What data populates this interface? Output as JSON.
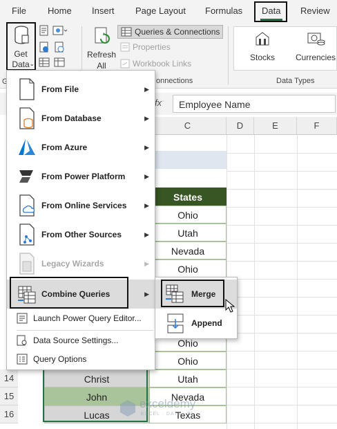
{
  "tabs": [
    "File",
    "Home",
    "Insert",
    "Page Layout",
    "Formulas",
    "Data",
    "Review"
  ],
  "active_tab": "Data",
  "ribbon": {
    "get_data": {
      "line1": "Get",
      "line2": "Data"
    },
    "refresh_all": {
      "line1": "Refresh",
      "line2": "All"
    },
    "queries_connections": "Queries & Connections",
    "properties": "Properties",
    "workbook_links": "Workbook Links",
    "connections_group": "onnections",
    "data_types_group": "Data Types",
    "group_left_fragment": "G",
    "stocks": "Stocks",
    "currencies": "Currencies"
  },
  "formula_bar": {
    "fx": "fx",
    "value": "Employee Name"
  },
  "columns": [
    "C",
    "D",
    "E",
    "F"
  ],
  "rows": [
    "14",
    "15",
    "16"
  ],
  "table": {
    "header": "States",
    "states": [
      "Ohio",
      "Utah",
      "Nevada",
      "Ohio",
      "",
      "",
      "Ohio",
      "Ohio",
      "Utah",
      "Nevada",
      "Texas"
    ],
    "names_visible": [
      "Christ",
      "John",
      "Lucas"
    ]
  },
  "menu": {
    "items": [
      {
        "label": "From File",
        "arrow": "▶"
      },
      {
        "label": "From Database",
        "arrow": "▶"
      },
      {
        "label": "From Azure",
        "arrow": "▶"
      },
      {
        "label": "From Power Platform",
        "arrow": "▶"
      },
      {
        "label": "From Online Services",
        "arrow": "▶"
      },
      {
        "label": "From Other Sources",
        "arrow": "▶"
      },
      {
        "label": "Legacy Wizards",
        "arrow": "▶"
      },
      {
        "label": "Combine Queries",
        "arrow": "▶"
      }
    ],
    "small_items": [
      "Launch Power Query Editor...",
      "Data Source Settings...",
      "Query Options"
    ]
  },
  "submenu": {
    "merge": "Merge",
    "append": "Append"
  },
  "watermark": {
    "brand": "exceldemy",
    "tagline": "EXCEL · DATA · BI"
  },
  "colors": {
    "header_green": "#375623",
    "name_green": "#a9c49a",
    "name_gray": "#d6d6d6",
    "highlight_border": "#111111",
    "excel_green": "#217346"
  }
}
